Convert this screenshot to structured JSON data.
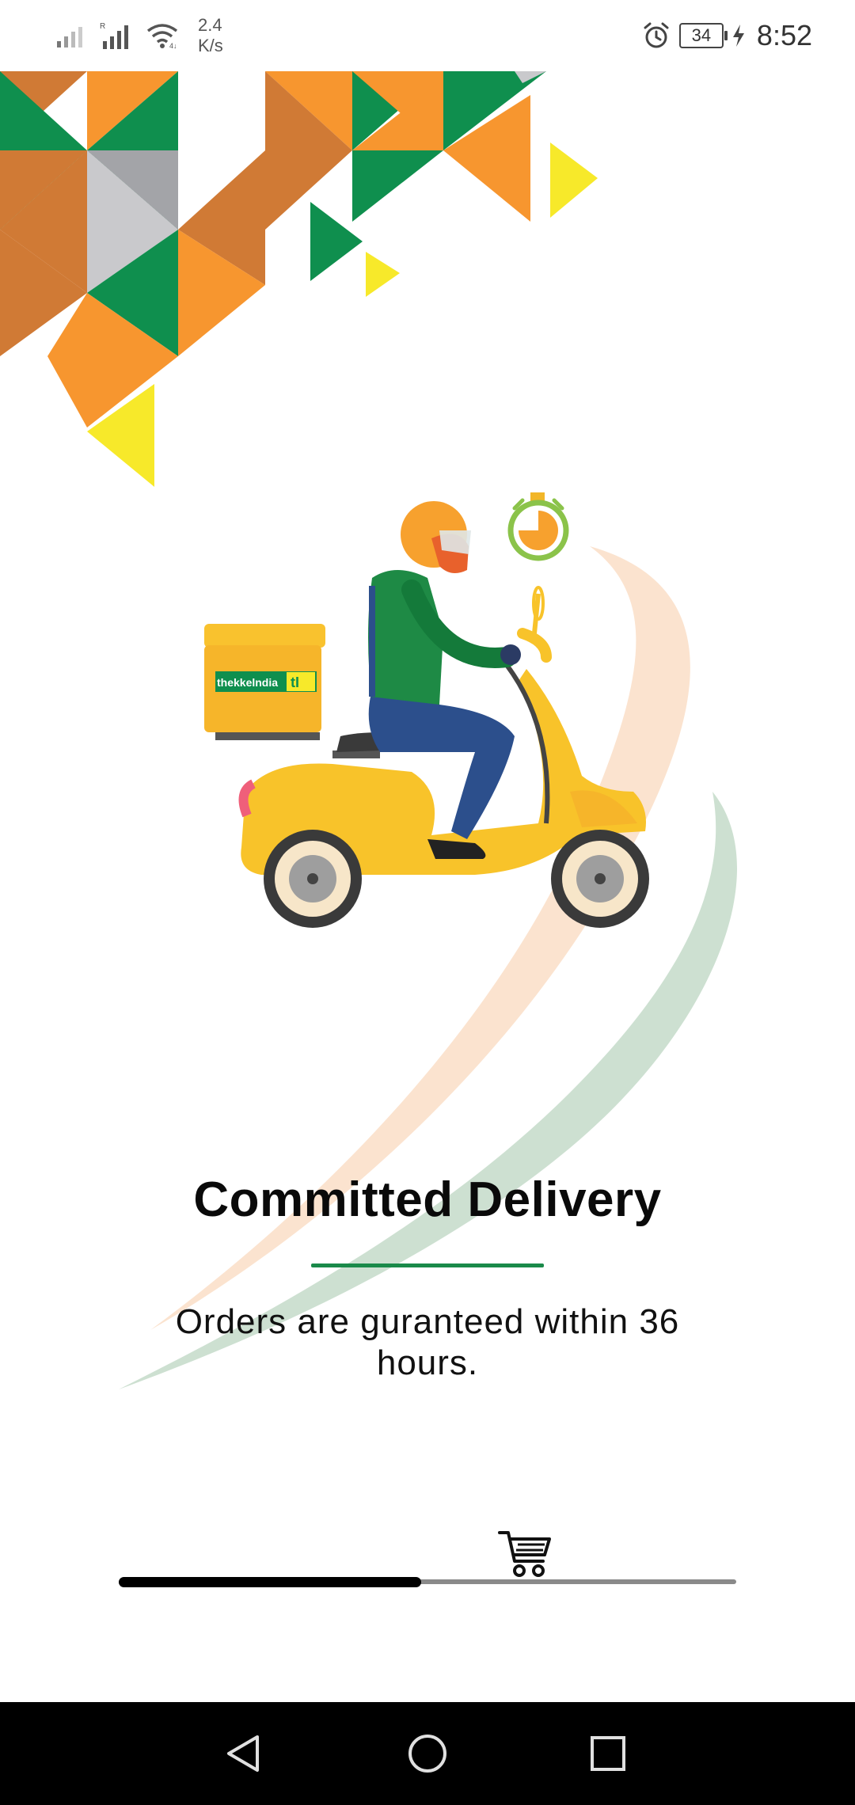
{
  "status_bar": {
    "net_speed_value": "2.4",
    "net_speed_unit": "K/s",
    "battery_level": "34",
    "time": "8:52",
    "icons": [
      "signal-icon",
      "signal-roaming-icon",
      "wifi-icon",
      "alarm-icon",
      "battery-icon",
      "charging-icon"
    ]
  },
  "illustration": {
    "brand_box_text": "thekkelndia",
    "brand_box_logo": "tI"
  },
  "onboarding": {
    "title": "Committed Delivery",
    "description": "Orders are guranteed within 36 hours.",
    "progress_fraction": 0.49,
    "progress_icon": "cart-icon"
  },
  "colors": {
    "accent_green": "#1a8a4a",
    "orange": "#f7962f",
    "dark_orange": "#d07a35",
    "green": "#0f8f4e",
    "yellow": "#f7e92a"
  },
  "nav_bar": {
    "buttons": [
      "back-icon",
      "home-icon",
      "recents-icon"
    ]
  }
}
